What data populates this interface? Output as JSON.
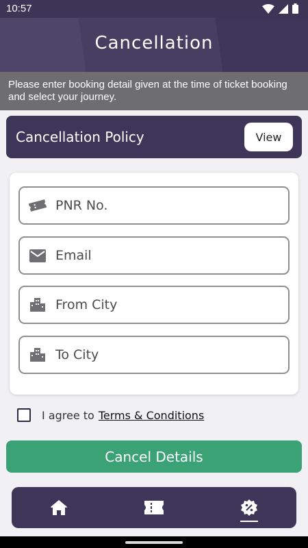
{
  "status_bar": {
    "time": "10:57"
  },
  "header": {
    "title": "Cancellation"
  },
  "notice": {
    "text": "Please enter booking detail given at the time of ticket booking and select your journey."
  },
  "policy": {
    "label": "Cancellation Policy",
    "view_label": "View"
  },
  "form": {
    "fields": [
      {
        "placeholder": "PNR No.",
        "icon": "ticket-icon"
      },
      {
        "placeholder": "Email",
        "icon": "mail-icon"
      },
      {
        "placeholder": "From City",
        "icon": "city-icon"
      },
      {
        "placeholder": "To City",
        "icon": "city-icon"
      }
    ]
  },
  "agreement": {
    "text": "I agree to",
    "link": "Terms & Conditions"
  },
  "submit": {
    "label": "Cancel Details"
  },
  "bottom_nav": {
    "items": [
      {
        "icon": "home-icon"
      },
      {
        "icon": "ticket-icon"
      },
      {
        "icon": "discount-icon",
        "active": true
      }
    ]
  },
  "colors": {
    "primary": "#3e3658",
    "accent": "#3ba275",
    "notice_bg": "#6e6d6f"
  }
}
